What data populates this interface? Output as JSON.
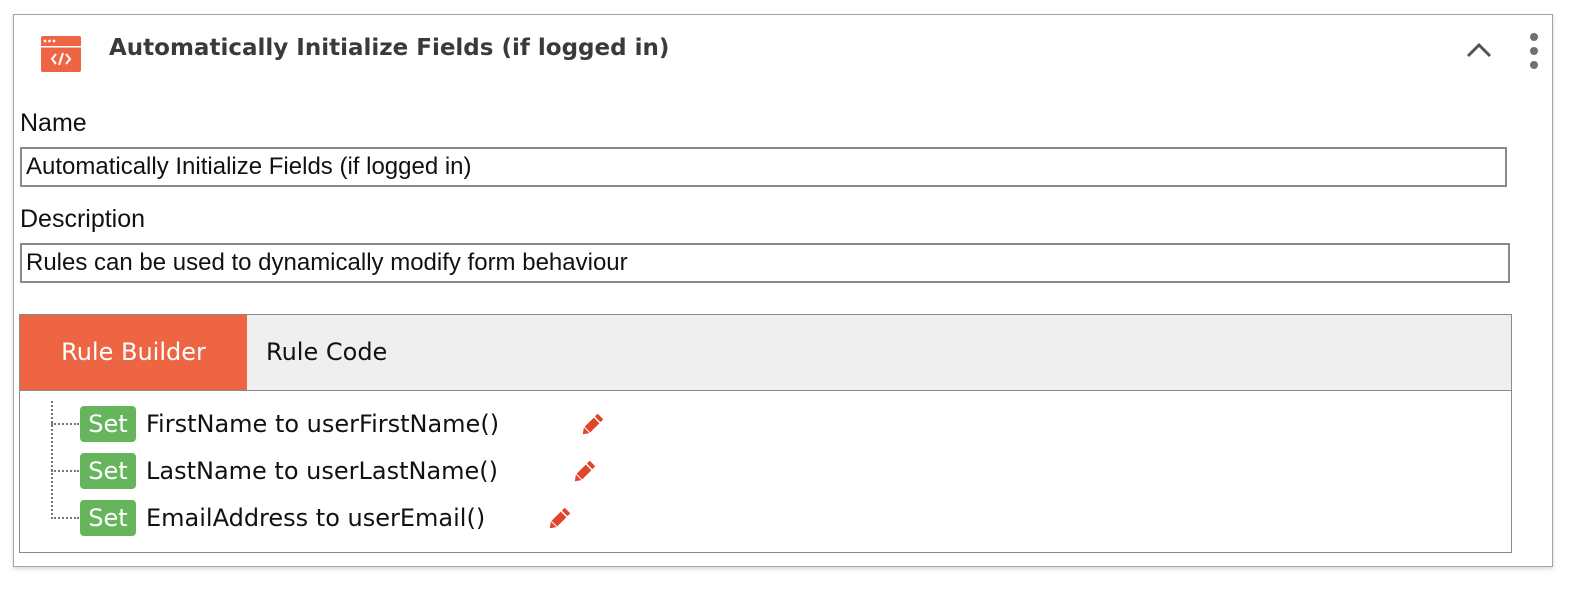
{
  "panel": {
    "title": "Automatically Initialize Fields (if logged in)",
    "icon": "code-window-icon",
    "accent_color": "#ee6543",
    "collapse_icon": "chevron-up-icon",
    "menu_icon": "more-vertical-icon"
  },
  "form": {
    "name_label": "Name",
    "name_value": "Automatically Initialize Fields (if logged in)",
    "description_label": "Description",
    "description_value": "Rules can be used to dynamically modify form behaviour"
  },
  "tabs": [
    {
      "label": "Rule Builder",
      "active": true
    },
    {
      "label": "Rule Code",
      "active": false
    }
  ],
  "rules": [
    {
      "action": "Set",
      "text": "FirstName to userFirstName()"
    },
    {
      "action": "Set",
      "text": "LastName to userLastName()"
    },
    {
      "action": "Set",
      "text": "EmailAddress to userEmail()"
    }
  ],
  "colors": {
    "set_badge": "#66b55c",
    "edit_icon": "#e0442a",
    "tab_bar": "#efefef"
  }
}
